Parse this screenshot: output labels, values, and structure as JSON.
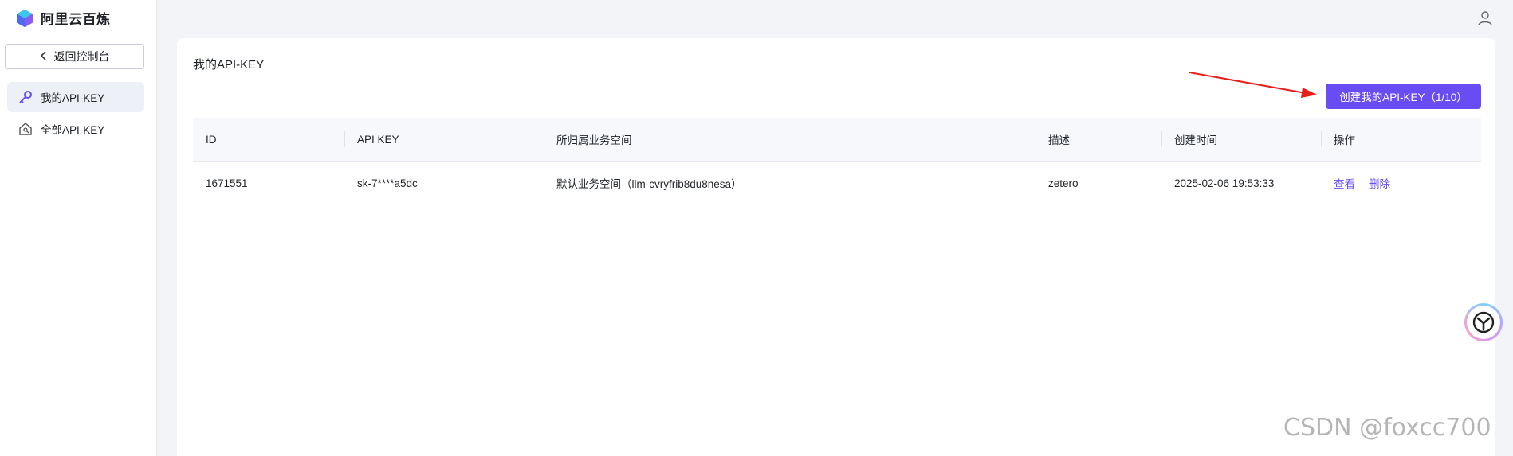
{
  "brand": {
    "name": "阿里云百炼",
    "logo_icon": "bailian-logo-icon"
  },
  "sidebar": {
    "back_label": "返回控制台",
    "items": [
      {
        "label": "我的API-KEY",
        "icon": "key-icon",
        "active": true
      },
      {
        "label": "全部API-KEY",
        "icon": "house-key-icon",
        "active": false
      }
    ]
  },
  "header": {
    "user_icon": "user-icon"
  },
  "main": {
    "title": "我的API-KEY",
    "create_button": "创建我的API-KEY（1/10）",
    "table": {
      "columns": [
        "ID",
        "API KEY",
        "所归属业务空间",
        "描述",
        "创建时间",
        "操作"
      ],
      "rows": [
        {
          "id": "1671551",
          "api_key": "sk-7****a5dc",
          "workspace": "默认业务空间（llm-cvryfrib8du8nesa）",
          "desc": "zetero",
          "created": "2025-02-06 19:53:33",
          "actions": [
            "查看",
            "删除"
          ]
        }
      ]
    }
  },
  "watermark": "CSDN @foxcc700",
  "colors": {
    "accent": "#6a4cf5",
    "annotation": "#e8201a"
  }
}
